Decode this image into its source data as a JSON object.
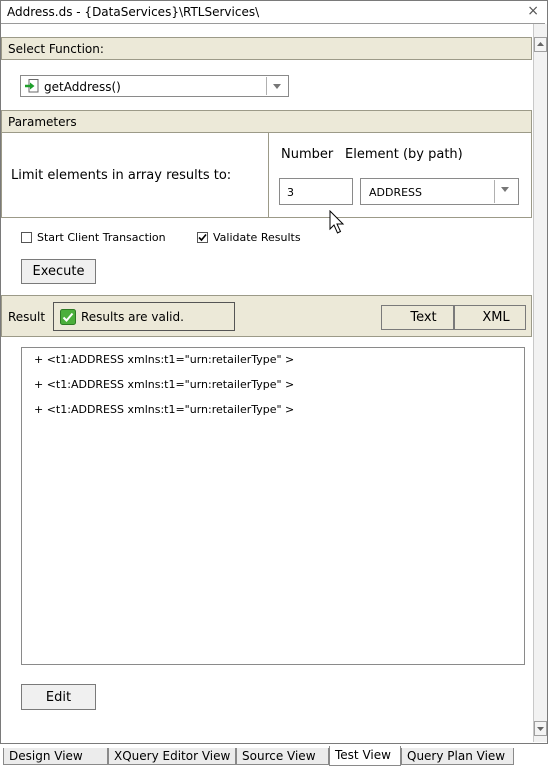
{
  "window": {
    "title": "Address.ds - {DataServices}\\RTLServices\\",
    "close_glyph": "×"
  },
  "select_function": {
    "label": "Select Function:",
    "selected": "getAddress()"
  },
  "parameters": {
    "label": "Parameters",
    "limit_label": "Limit elements in array results to:",
    "number_header": "Number",
    "number_value": "3",
    "element_header": "Element (by path)",
    "element_value": "ADDRESS"
  },
  "options": {
    "start_client_transaction": {
      "label": "Start Client Transaction",
      "checked": false
    },
    "validate_results": {
      "label": "Validate Results",
      "checked": true
    }
  },
  "execute_label": "Execute",
  "result": {
    "label": "Result",
    "status_text": "Results are valid.",
    "text_button": "Text",
    "xml_button": "XML",
    "lines": [
      "+ <t1:ADDRESS xmlns:t1=\"urn:retailerType\" >",
      "+ <t1:ADDRESS xmlns:t1=\"urn:retailerType\" >",
      "+ <t1:ADDRESS xmlns:t1=\"urn:retailerType\" >"
    ]
  },
  "edit_label": "Edit",
  "tabs": [
    {
      "label": "Design View",
      "active": false
    },
    {
      "label": "XQuery Editor View",
      "active": false
    },
    {
      "label": "Source View",
      "active": false
    },
    {
      "label": "Test View",
      "active": true
    },
    {
      "label": "Query Plan View",
      "active": false
    }
  ],
  "colors": {
    "section_bg": "#ece9d8",
    "valid_green": "#4caf3c",
    "function_icon_green": "#1e9e2a"
  }
}
